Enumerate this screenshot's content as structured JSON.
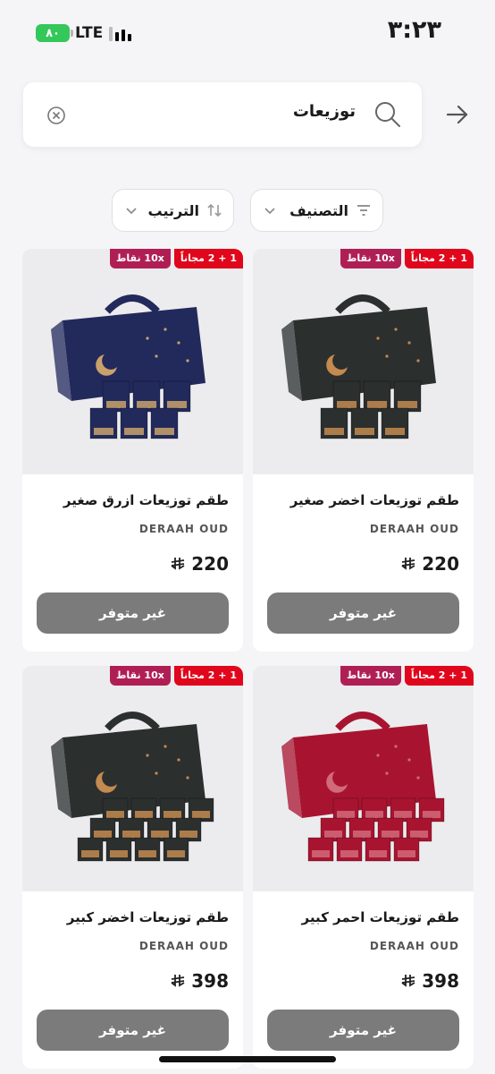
{
  "status_bar": {
    "time": "٣:٢٣",
    "battery": "٨٠",
    "network": "LTE"
  },
  "search": {
    "query": "توزيعات"
  },
  "filters": {
    "category_label": "التصنيف",
    "sort_label": "الترتيب"
  },
  "products": [
    {
      "name": "طقم توزيعات اخضر صغير",
      "brand": "DERAAH OUD",
      "price": "220",
      "badge_free": "1 + 2 مجاناً",
      "badge_points": "10x نقاط",
      "cta": "غير متوفر",
      "box_color": "#2b2f2e",
      "accent": "#c48a50"
    },
    {
      "name": "طقم توزيعات ازرق صغير",
      "brand": "DERAAH OUD",
      "price": "220",
      "badge_free": "1 + 2 مجاناً",
      "badge_points": "10x نقاط",
      "cta": "غير متوفر",
      "box_color": "#222a5c",
      "accent": "#c9a26a"
    },
    {
      "name": "طقم توزيعات احمر كبير",
      "brand": "DERAAH OUD",
      "price": "398",
      "badge_free": "1 + 2 مجاناً",
      "badge_points": "10x نقاط",
      "cta": "غير متوفر",
      "box_color": "#a81430",
      "accent": "#d16a7a"
    },
    {
      "name": "طقم توزيعات اخضر كبير",
      "brand": "DERAAH OUD",
      "price": "398",
      "badge_free": "1 + 2 مجاناً",
      "badge_points": "10x نقاط",
      "cta": "غير متوفر",
      "box_color": "#2b2f2e",
      "accent": "#c48a50"
    }
  ]
}
